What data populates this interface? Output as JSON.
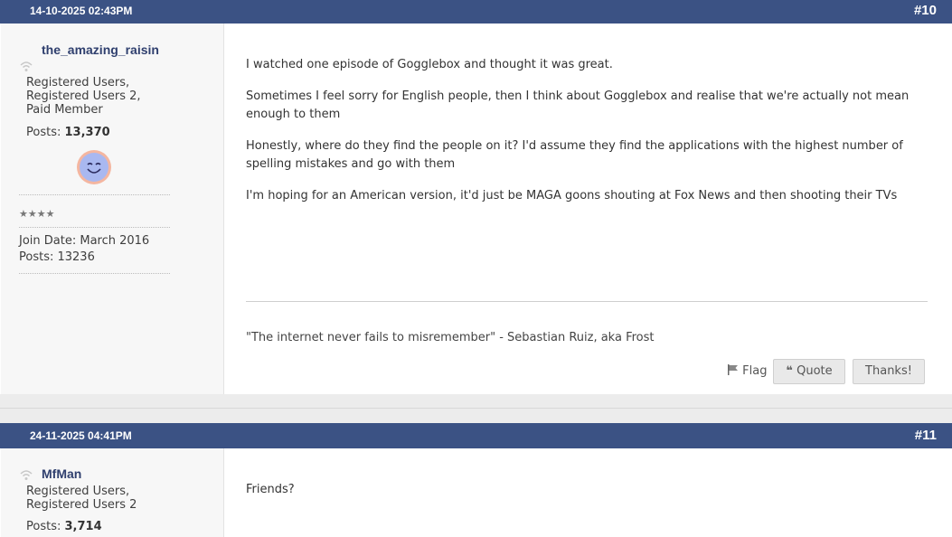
{
  "posts": [
    {
      "date": "14-10-2025 02:43PM",
      "number": "#10",
      "user": {
        "name": "the_amazing_raisin",
        "title_lines": [
          "Registered Users,",
          "Registered Users 2,",
          "Paid Member"
        ],
        "posts_label": "Posts:",
        "posts_count": "13,370",
        "stars": "★★★★",
        "join_date": "Join Date: March 2016",
        "post_total": "Posts: 13236"
      },
      "paragraphs": [
        "I watched one episode of Gogglebox and thought it was great.",
        "Sometimes I feel sorry for English people, then I think about Gogglebox and realise that we're actually not mean enough to them",
        "Honestly, where do they find the people on it? I'd assume they find the applications with the highest number of spelling mistakes and go with them",
        "I'm hoping for an American version, it'd just be MAGA goons shouting at Fox News and then shooting their TVs"
      ],
      "signature": "\"The internet never fails to misremember\" - Sebastian Ruiz, aka Frost",
      "actions": {
        "flag": "Flag",
        "quote": "Quote",
        "thanks": "Thanks!"
      }
    },
    {
      "date": "24-11-2025 04:41PM",
      "number": "#11",
      "user": {
        "name": "MfMan",
        "title_lines": [
          "Registered Users,",
          "Registered Users 2"
        ],
        "posts_label": "Posts:",
        "posts_count": "3,714"
      },
      "paragraphs": [
        "Friends?"
      ]
    }
  ],
  "colors": {
    "header": "#3b5284",
    "username": "#2f3f6e"
  }
}
